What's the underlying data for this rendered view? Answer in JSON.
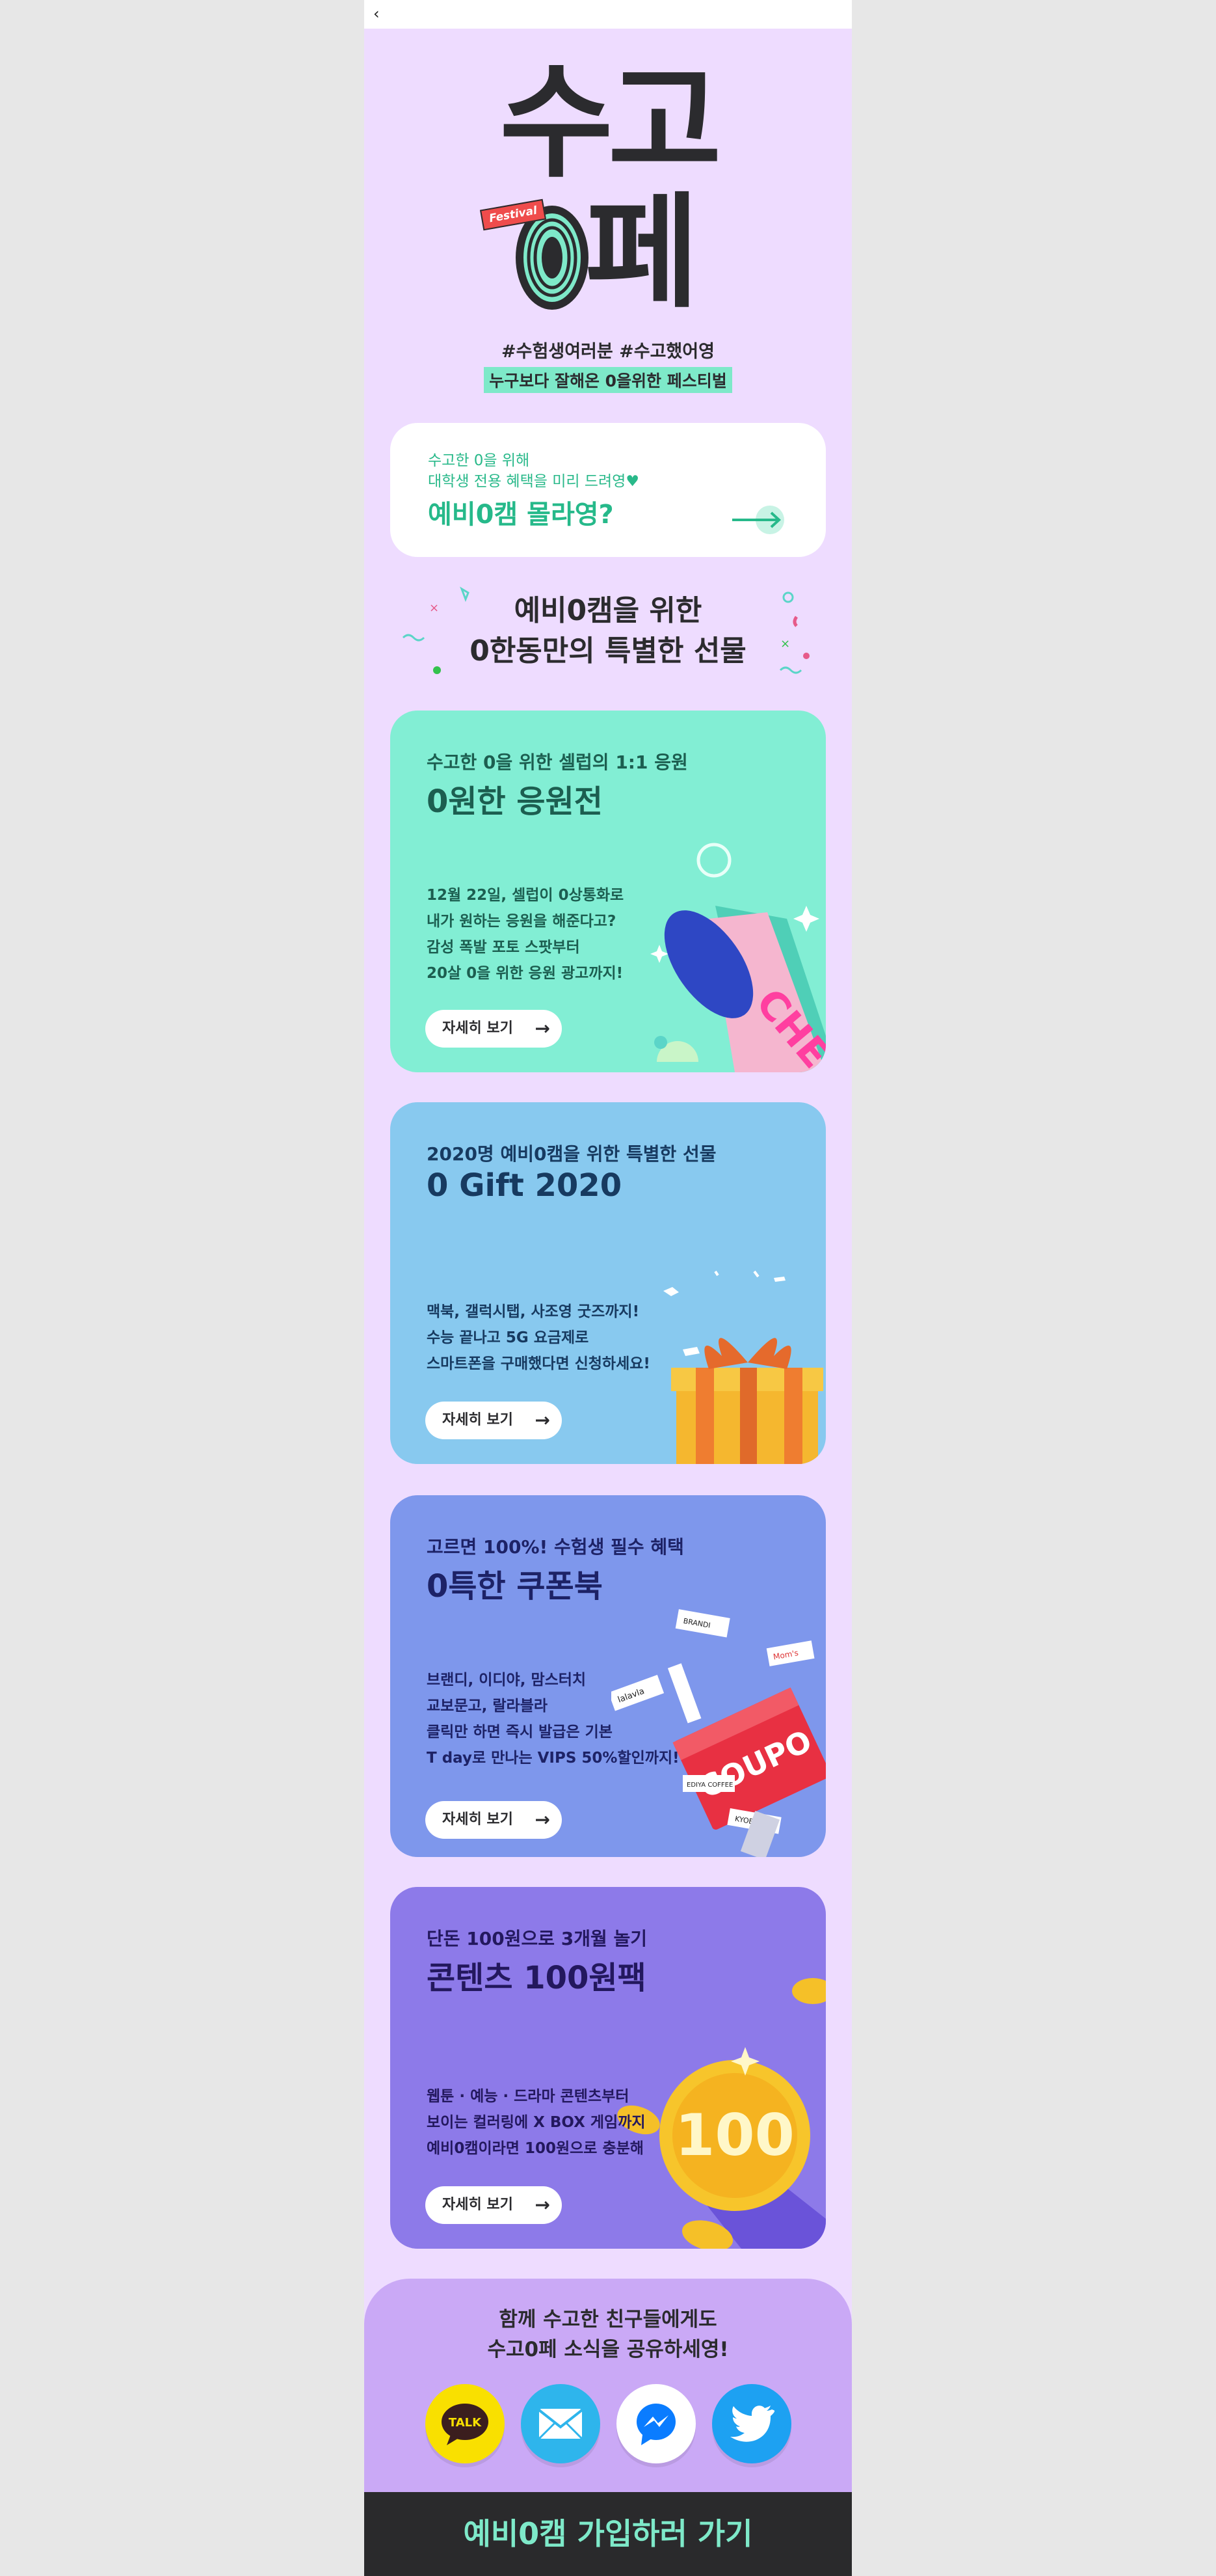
{
  "nav": {
    "back_label": "‹"
  },
  "hero": {
    "title_top": "수고",
    "title_bottom": "페",
    "badge": "Festival",
    "hashtags": "#수험생여러분  #수고했어영",
    "tagline": "누구보다 잘해온 0을위한 페스티벌"
  },
  "promo": {
    "line1": "수고한 0을 위해",
    "line2": "대학생 전용 혜택을 미리 드려영♥",
    "title": "예비0캠 몰라영?"
  },
  "gifts": {
    "heading_line1": "예비0캠을 위한",
    "heading_line2": "0한동만의 특별한 선물"
  },
  "cards": [
    {
      "sub": "수고한 0을 위한 셀럽의 1:1 응원",
      "title": "0원한 응원전",
      "body": [
        "12월 22일, 셀럽이 0상통화로",
        "내가 원하는 응원을 해준다고?",
        "감성 폭발 포토 스팟부터",
        "20살 0을 위한 응원 광고까지!"
      ],
      "more": "자세히 보기",
      "illus_text": "CHEER"
    },
    {
      "sub": "2020명 예비0캠을 위한 특별한 선물",
      "title": "0 Gift 2020",
      "body": [
        "맥북, 갤럭시탭, 사조영 굿즈까지!",
        "수능 끝나고 5G 요금제로",
        "스마트폰을 구매했다면 신청하세요!"
      ],
      "more": "자세히 보기"
    },
    {
      "sub": "고르면 100%! 수험생 필수 혜택",
      "title": "0특한 쿠폰북",
      "body": [
        "브랜디, 이디야, 맘스터치",
        "교보문고, 랄라블라",
        "클릭만 하면 즉시 발급은 기본",
        "T day로 만나는 VIPS 50%할인까지!"
      ],
      "more": "자세히 보기",
      "illus_text": "COUPO",
      "ticket_labels": [
        "BRANDI",
        "Mom's",
        "lalavla",
        "EDIYA COFFEE",
        "KYOBO"
      ]
    },
    {
      "sub": "단돈 100원으로 3개월 놀기",
      "title": "콘텐츠 100원팩",
      "body": [
        "웹툰 · 예능 · 드라마 콘텐츠부터",
        "보이는 컬러링에 X BOX 게임까지",
        "예비0캠이라면 100원으로 충분해"
      ],
      "more": "자세히 보기",
      "illus_text": "100"
    }
  ],
  "share": {
    "line1": "함께 수고한 친구들에게도",
    "line2": "수고0페 소식을 공유하세영!",
    "kakao_label": "TALK",
    "colors": {
      "kakao": "#f9e000",
      "mail": "#2eb5ec",
      "messenger": "#ffffff",
      "twitter": "#1da1f2"
    }
  },
  "cta": {
    "label": "예비0캠 가입하러 가기"
  },
  "colors": {
    "mint": "#7ee9c9",
    "dark": "#2b2b2e",
    "lavender": "#eedcff"
  }
}
